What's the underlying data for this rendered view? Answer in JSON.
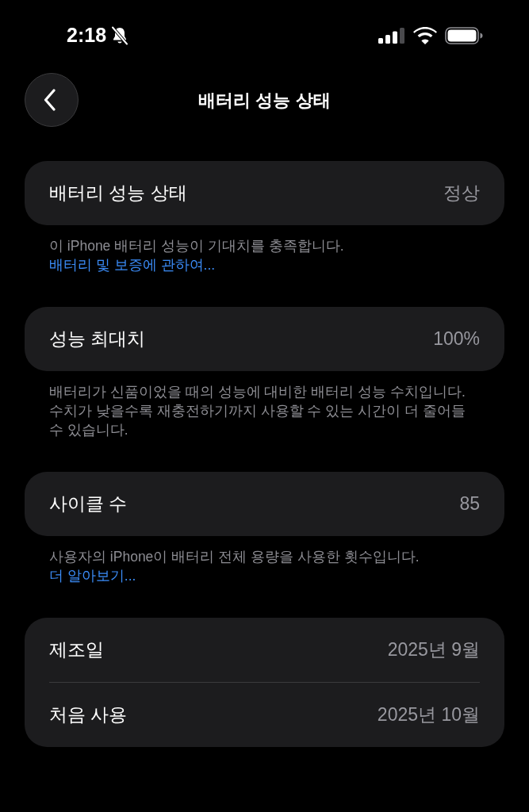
{
  "status_bar": {
    "time": "2:18"
  },
  "nav": {
    "title": "배터리 성능 상태"
  },
  "sections": [
    {
      "rows": [
        {
          "label": "배터리 성능 상태",
          "value": "정상"
        }
      ],
      "footer": {
        "text": "이 iPhone 배터리 성능이 기대치를 충족합니다.",
        "link": "배터리 및 보증에 관하여..."
      }
    },
    {
      "rows": [
        {
          "label": "성능 최대치",
          "value": "100%"
        }
      ],
      "footer": {
        "text": "배터리가 신품이었을 때의 성능에 대비한 배터리 성능 수치입니다. 수치가 낮을수록 재충전하기까지 사용할 수 있는 시간이 더 줄어들 수 있습니다."
      }
    },
    {
      "rows": [
        {
          "label": "사이클 수",
          "value": "85"
        }
      ],
      "footer": {
        "text": "사용자의 iPhone이 배터리 전체 용량을 사용한 횟수입니다.",
        "link": "더 알아보기..."
      }
    },
    {
      "rows": [
        {
          "label": "제조일",
          "value": "2025년 9월"
        },
        {
          "label": "처음 사용",
          "value": "2025년 10월"
        }
      ]
    }
  ]
}
